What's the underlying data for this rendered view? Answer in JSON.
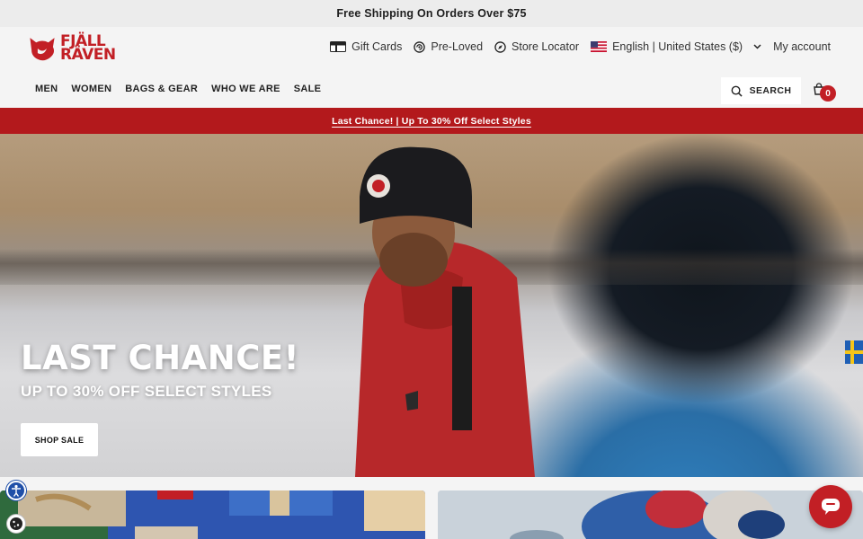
{
  "announcement": {
    "text": "Free Shipping On Orders Over $75"
  },
  "logo": {
    "line1": "FJÄLL",
    "line2": "RÄVEN"
  },
  "utility": {
    "gift_cards": "Gift Cards",
    "pre_loved": "Pre-Loved",
    "store_locator": "Store Locator",
    "locale": "English | United States ($)",
    "my_account": "My account"
  },
  "nav": {
    "items": [
      "MEN",
      "WOMEN",
      "BAGS & GEAR",
      "WHO WE ARE",
      "SALE"
    ]
  },
  "search": {
    "label": "SEARCH"
  },
  "cart": {
    "count": "0"
  },
  "promo": {
    "text": "Last Chance! | Up To 30% Off Select Styles"
  },
  "hero": {
    "title": "LAST CHANCE!",
    "subtitle": "UP TO 30% OFF SELECT STYLES",
    "cta": "SHOP SALE"
  },
  "colors": {
    "brand_red": "#c21f25",
    "promo_red": "#b3191c",
    "announce_bg": "#ececec",
    "header_bg": "#f4f4f4"
  },
  "icons": {
    "gift": "gift-card-icon",
    "preloved": "pre-loved-icon",
    "store": "compass-icon",
    "flag": "us-flag-icon",
    "search": "search-icon",
    "cart": "bag-icon",
    "chat": "chat-icon",
    "accessibility": "accessibility-icon",
    "cookie": "cookie-icon"
  }
}
